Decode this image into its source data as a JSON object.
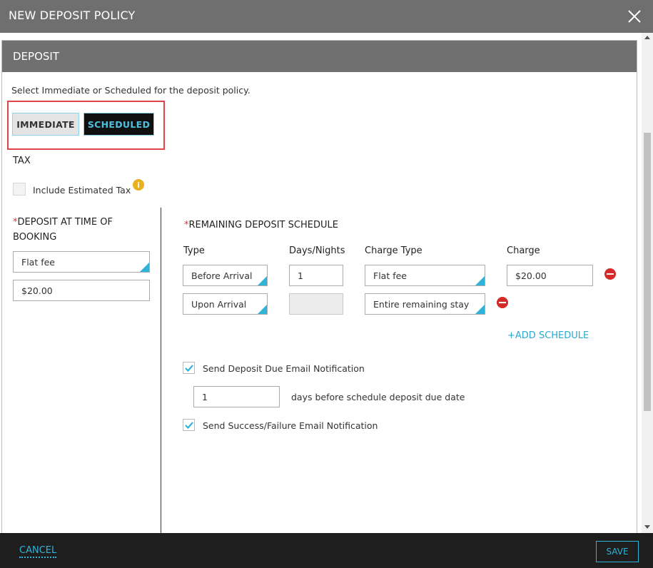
{
  "dialog": {
    "title": "NEW DEPOSIT POLICY",
    "close_icon": "close-icon"
  },
  "section": {
    "title": "DEPOSIT",
    "intro": "Select Immediate or Scheduled for the deposit policy.",
    "mode_toggle": {
      "immediate_label": "IMMEDIATE",
      "scheduled_label": "SCHEDULED",
      "selected": "SCHEDULED"
    }
  },
  "tax": {
    "title": "TAX",
    "include_label": "Include Estimated Tax",
    "include_checked": false,
    "info_icon": "i"
  },
  "booking": {
    "required_mark": "*",
    "title": "DEPOSIT AT TIME OF BOOKING",
    "type_value": "Flat fee",
    "amount_value": "$20.00"
  },
  "schedule": {
    "required_mark": "*",
    "title": "REMAINING DEPOSIT SCHEDULE",
    "columns": [
      "Type",
      "Days/Nights",
      "Charge Type",
      "Charge"
    ],
    "rows": [
      {
        "type": "Before Arrival",
        "days": "1",
        "charge_type": "Flat fee",
        "charge": "$20.00"
      },
      {
        "type": "Upon Arrival",
        "days": "",
        "charge_type": "Entire remaining stay",
        "charge": ""
      }
    ],
    "add_label": "+ADD SCHEDULE"
  },
  "notifications": {
    "due_email_label": "Send Deposit Due Email Notification",
    "due_email_checked": true,
    "days_before_value": "1",
    "days_before_label": "days before schedule deposit due date",
    "success_email_label": "Send Success/Failure Email Notification",
    "success_email_checked": true
  },
  "footer": {
    "cancel_label": "CANCEL",
    "save_label": "SAVE"
  },
  "colors": {
    "accent": "#2fb4d8",
    "header_gray": "#6f6f6f",
    "highlight_frame": "#e0454a",
    "remove": "#d42a2a",
    "info": "#e9b020"
  }
}
